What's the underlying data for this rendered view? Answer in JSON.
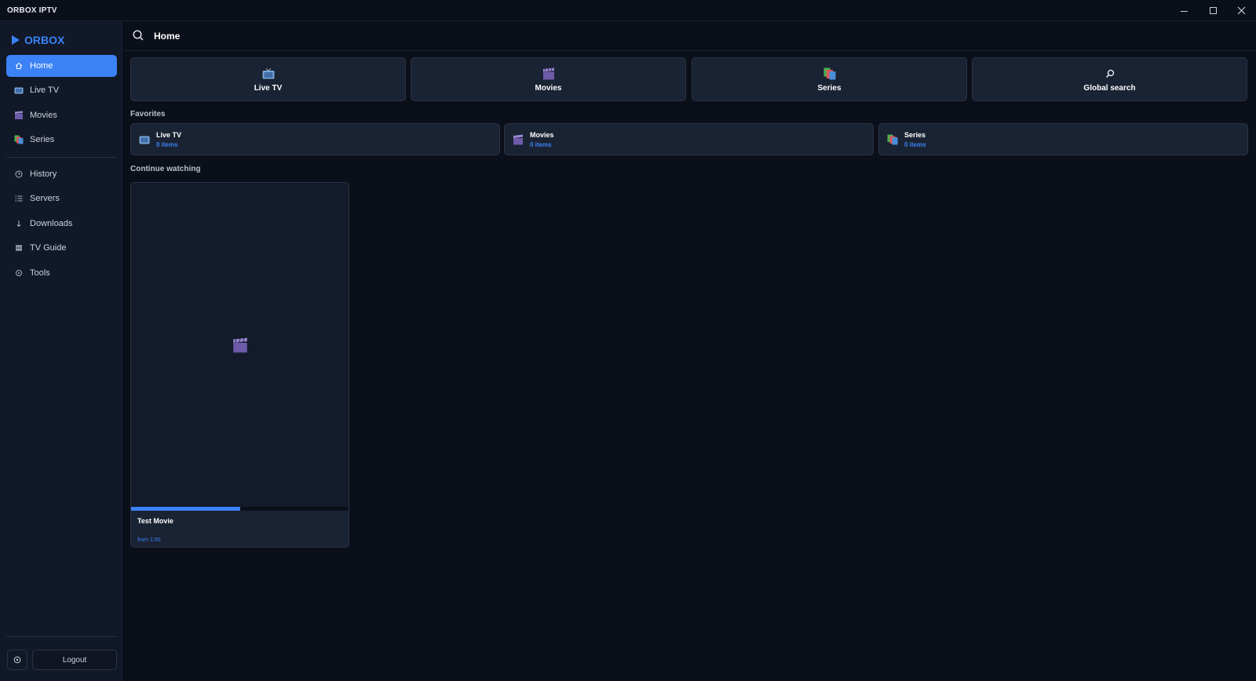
{
  "window": {
    "title": "ORBOX IPTV"
  },
  "sidebar": {
    "logo": "ORBOX",
    "primary": [
      {
        "label": "Home",
        "icon": "home-icon"
      },
      {
        "label": "Live TV",
        "icon": "tv-icon"
      },
      {
        "label": "Movies",
        "icon": "clapper-icon"
      },
      {
        "label": "Series",
        "icon": "series-icon"
      }
    ],
    "secondary": [
      {
        "label": "History",
        "icon": "clock-icon"
      },
      {
        "label": "Servers",
        "icon": "list-icon"
      },
      {
        "label": "Downloads",
        "icon": "download-icon"
      },
      {
        "label": "TV Guide",
        "icon": "guide-icon"
      },
      {
        "label": "Tools",
        "icon": "tools-icon"
      }
    ],
    "active": "Home",
    "logout_label": "Logout"
  },
  "header": {
    "title": "Home"
  },
  "quick_tiles": [
    {
      "label": "Live TV",
      "icon": "tv-icon"
    },
    {
      "label": "Movies",
      "icon": "clapper-icon"
    },
    {
      "label": "Series",
      "icon": "series-icon"
    },
    {
      "label": "Global search",
      "icon": "search-icon"
    }
  ],
  "favorites": {
    "title": "Favorites",
    "items": [
      {
        "name": "Live TV",
        "count": "0 items",
        "icon": "tv-icon"
      },
      {
        "name": "Movies",
        "count": "0 items",
        "icon": "clapper-icon"
      },
      {
        "name": "Series",
        "count": "0 items",
        "icon": "series-icon"
      }
    ]
  },
  "continue_watching": {
    "title": "Continue watching",
    "items": [
      {
        "title": "Test Movie",
        "subtitle": "from 1:00",
        "progress": 0.5,
        "icon": "clapper-icon"
      }
    ]
  },
  "colors": {
    "accent": "#3b82f6",
    "background": "#0b0f19",
    "sidebar": "#111827",
    "card": "#1a2333"
  }
}
